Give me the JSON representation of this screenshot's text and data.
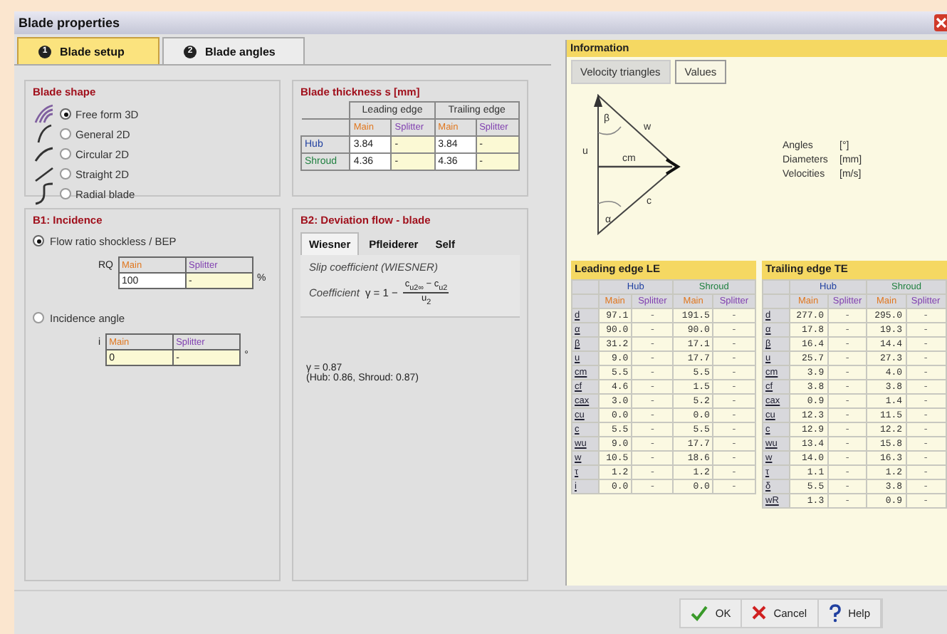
{
  "window": {
    "title": "Blade properties"
  },
  "tabs": [
    {
      "number": "1",
      "label": "Blade setup",
      "selected": true
    },
    {
      "number": "2",
      "label": "Blade angles",
      "selected": false
    }
  ],
  "blade_shape": {
    "title": "Blade shape",
    "options": [
      {
        "label": "Free form 3D",
        "selected": true
      },
      {
        "label": "General 2D",
        "selected": false
      },
      {
        "label": "Circular 2D",
        "selected": false
      },
      {
        "label": "Straight 2D",
        "selected": false
      },
      {
        "label": "Radial blade",
        "selected": false
      }
    ]
  },
  "blade_thickness": {
    "title": "Blade thickness s [mm]",
    "groups": [
      "Leading edge",
      "Trailing edge"
    ],
    "subheaders": [
      "Main",
      "Splitter",
      "Main",
      "Splitter"
    ],
    "rows": [
      {
        "label": "Hub",
        "cells": [
          "3.84",
          "-",
          "3.84",
          "-"
        ]
      },
      {
        "label": "Shroud",
        "cells": [
          "4.36",
          "-",
          "4.36",
          "-"
        ]
      }
    ]
  },
  "incidence": {
    "title": "B1: Incidence",
    "options": [
      {
        "label": "Flow ratio shockless / BEP",
        "selected": true,
        "symbol": "RQ",
        "headers": [
          "Main",
          "Splitter"
        ],
        "values": [
          "100",
          "-"
        ],
        "unit": "%"
      },
      {
        "label": "Incidence angle",
        "selected": false,
        "symbol": "i",
        "headers": [
          "Main",
          "Splitter"
        ],
        "values": [
          "0",
          "-"
        ],
        "unit": "°"
      }
    ]
  },
  "deviation": {
    "title": "B2: Deviation flow - blade",
    "tabs": [
      {
        "label": "Wiesner",
        "selected": true
      },
      {
        "label": "Pfleiderer",
        "selected": false
      },
      {
        "label": "Self",
        "selected": false
      }
    ],
    "subtitle": "Slip coefficient  (WIESNER)",
    "formula_label": "Coefficient",
    "formula_lhs": "γ = 1 −",
    "numerator": "c$_{u2∞}$ − c$_{u2}$",
    "denominator": "u$_{2}$",
    "result": "γ = 0.87",
    "detail": "(Hub: 0.86,  Shroud: 0.87)"
  },
  "information": {
    "title": "Information",
    "tabs": [
      {
        "label": "Velocity triangles",
        "selected": false
      },
      {
        "label": "Values",
        "selected": true
      }
    ],
    "triangle_labels": {
      "beta": "β",
      "w": "w",
      "u": "u",
      "cm": "cm",
      "c": "c",
      "alpha": "α"
    },
    "units": [
      {
        "name": "Angles",
        "unit": "[°]"
      },
      {
        "name": "Diameters",
        "unit": "[mm]"
      },
      {
        "name": "Velocities",
        "unit": "[m/s]"
      }
    ],
    "tables": [
      {
        "title": "Leading edge LE",
        "groups": [
          "Hub",
          "Shroud"
        ],
        "subheaders": [
          "Main",
          "Splitter",
          "Main",
          "Splitter"
        ],
        "rows": [
          {
            "symbol": "d",
            "values": [
              "97.1",
              "-",
              "191.5",
              "-"
            ]
          },
          {
            "symbol": "α",
            "values": [
              "90.0",
              "-",
              "90.0",
              "-"
            ]
          },
          {
            "symbol": "β",
            "values": [
              "31.2",
              "-",
              "17.1",
              "-"
            ]
          },
          {
            "symbol": "u",
            "values": [
              "9.0",
              "-",
              "17.7",
              "-"
            ]
          },
          {
            "symbol": "cm",
            "values": [
              "5.5",
              "-",
              "5.5",
              "-"
            ]
          },
          {
            "symbol": "cf",
            "values": [
              "4.6",
              "-",
              "1.5",
              "-"
            ]
          },
          {
            "symbol": "cax",
            "values": [
              "3.0",
              "-",
              "5.2",
              "-"
            ]
          },
          {
            "symbol": "cu",
            "values": [
              "0.0",
              "-",
              "0.0",
              "-"
            ]
          },
          {
            "symbol": "c",
            "values": [
              "5.5",
              "-",
              "5.5",
              "-"
            ]
          },
          {
            "symbol": "wu",
            "values": [
              "9.0",
              "-",
              "17.7",
              "-"
            ]
          },
          {
            "symbol": "w",
            "values": [
              "10.5",
              "-",
              "18.6",
              "-"
            ]
          },
          {
            "symbol": "τ",
            "values": [
              "1.2",
              "-",
              "1.2",
              "-"
            ]
          },
          {
            "symbol": "i",
            "values": [
              "0.0",
              "-",
              "0.0",
              "-"
            ]
          }
        ]
      },
      {
        "title": "Trailing edge TE",
        "groups": [
          "Hub",
          "Shroud"
        ],
        "subheaders": [
          "Main",
          "Splitter",
          "Main",
          "Splitter"
        ],
        "rows": [
          {
            "symbol": "d",
            "values": [
              "277.0",
              "-",
              "295.0",
              "-"
            ]
          },
          {
            "symbol": "α",
            "values": [
              "17.8",
              "-",
              "19.3",
              "-"
            ]
          },
          {
            "symbol": "β",
            "values": [
              "16.4",
              "-",
              "14.4",
              "-"
            ]
          },
          {
            "symbol": "u",
            "values": [
              "25.7",
              "-",
              "27.3",
              "-"
            ]
          },
          {
            "symbol": "cm",
            "values": [
              "3.9",
              "-",
              "4.0",
              "-"
            ]
          },
          {
            "symbol": "cf",
            "values": [
              "3.8",
              "-",
              "3.8",
              "-"
            ]
          },
          {
            "symbol": "cax",
            "values": [
              "0.9",
              "-",
              "1.4",
              "-"
            ]
          },
          {
            "symbol": "cu",
            "values": [
              "12.3",
              "-",
              "11.5",
              "-"
            ]
          },
          {
            "symbol": "c",
            "values": [
              "12.9",
              "-",
              "12.2",
              "-"
            ]
          },
          {
            "symbol": "wu",
            "values": [
              "13.4",
              "-",
              "15.8",
              "-"
            ]
          },
          {
            "symbol": "w",
            "values": [
              "14.0",
              "-",
              "16.3",
              "-"
            ]
          },
          {
            "symbol": "τ",
            "values": [
              "1.1",
              "-",
              "1.2",
              "-"
            ]
          },
          {
            "symbol": "δ",
            "values": [
              "5.5",
              "-",
              "3.8",
              "-"
            ]
          },
          {
            "symbol": "wR",
            "values": [
              "1.3",
              "-",
              "0.9",
              "-"
            ]
          }
        ]
      }
    ]
  },
  "buttons": [
    {
      "label": "OK",
      "kind": "ok"
    },
    {
      "label": "Cancel",
      "kind": "cancel"
    },
    {
      "label": "Help",
      "kind": "help"
    }
  ]
}
